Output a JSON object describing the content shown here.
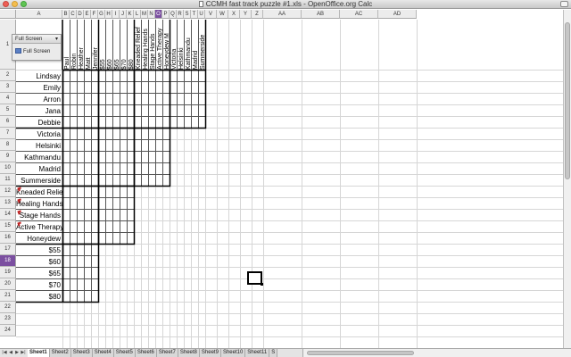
{
  "window": {
    "title": "CCMH fast track puzzle #1.xls - OpenOffice.org Calc"
  },
  "columns": [
    "A",
    "B",
    "C",
    "D",
    "E",
    "F",
    "G",
    "H",
    "I",
    "J",
    "K",
    "L",
    "M",
    "N",
    "O",
    "P",
    "Q",
    "R",
    "S",
    "T",
    "U",
    "V",
    "W",
    "X",
    "Y",
    "Z",
    "AA",
    "AB",
    "AC",
    "AD"
  ],
  "selected_column": "O",
  "rows": [
    "1",
    "2",
    "3",
    "4",
    "5",
    "6",
    "7",
    "8",
    "9",
    "10",
    "11",
    "12",
    "13",
    "14",
    "15",
    "16",
    "17",
    "18",
    "19",
    "20",
    "21",
    "22",
    "23",
    "24"
  ],
  "selected_row": "18",
  "row_labels": [
    "Lindsay",
    "Emily",
    "Arron",
    "Jana",
    "Debbie",
    "Victoria",
    "Helsinki",
    "Kathmandu",
    "Madrid",
    "Summerside",
    "Kneaded Relief",
    "Healing Hands",
    "Stage Hands",
    "Active Therapy",
    "Honeydew",
    "$55",
    "$60",
    "$65",
    "$70",
    "$80"
  ],
  "col_labels": [
    "Paul",
    "Robin",
    "Heather",
    "Matt",
    "Jennifer",
    "$55",
    "$60",
    "$65",
    "$70",
    "$80",
    "Kneaded Relief",
    "Healing Hands",
    "Stage Hands",
    "Active Therapy",
    "Honeydew M",
    "Victoria",
    "Helsinki",
    "Kathmandu",
    "Madrid",
    "Summerside"
  ],
  "toolbar": {
    "title": "Full Screen",
    "button_label": "Full Screen"
  },
  "sheet_tabs": [
    "Sheet1",
    "Sheet2",
    "Sheet3",
    "Sheet4",
    "Sheet5",
    "Sheet6",
    "Sheet7",
    "Sheet8",
    "Sheet9",
    "Sheet10",
    "Sheet11",
    "S"
  ],
  "active_tab": "Sheet1"
}
